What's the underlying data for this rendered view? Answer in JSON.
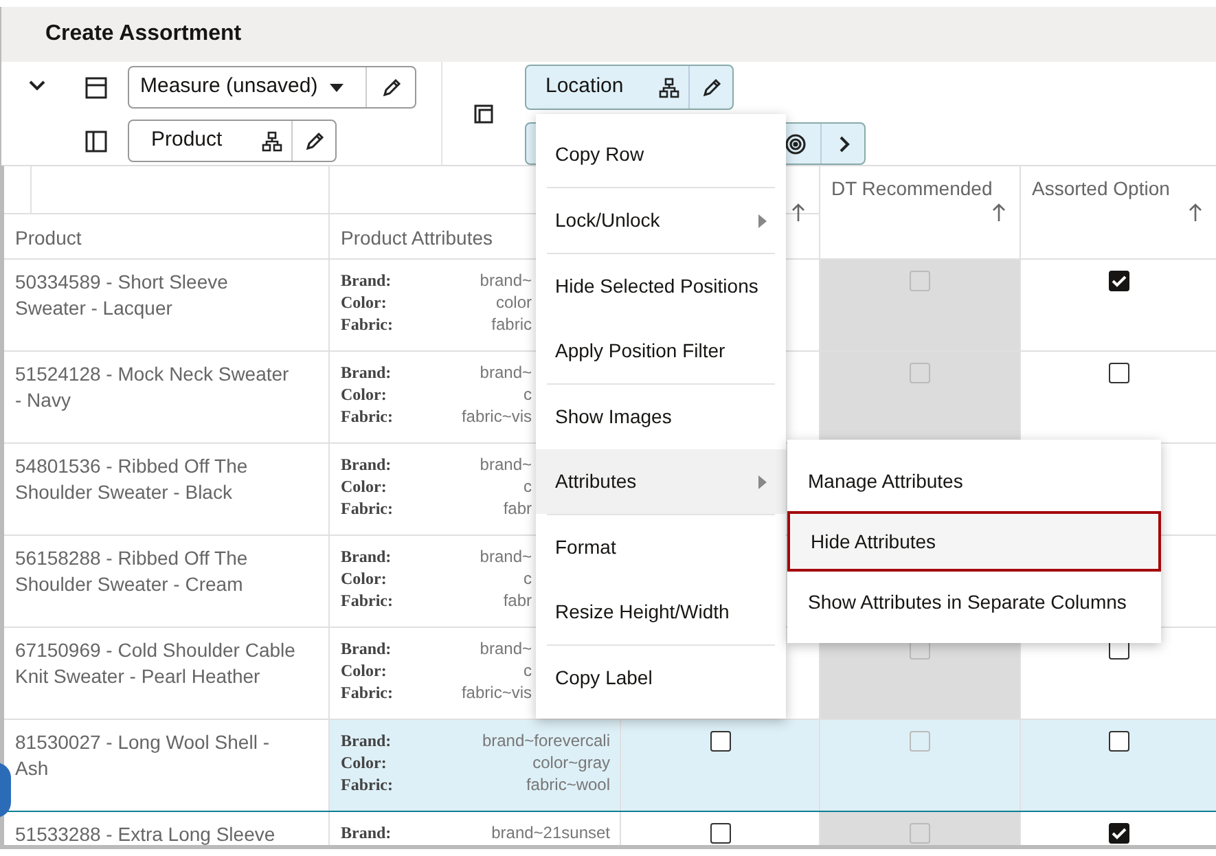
{
  "title": "Create Assortment",
  "toolbar": {
    "expanded": true,
    "measure": {
      "label": "Measure (unsaved)"
    },
    "product": {
      "label": "Product"
    },
    "location": {
      "label": "Location"
    }
  },
  "table": {
    "columns": [
      {
        "label": "Product",
        "sortable": false
      },
      {
        "label": "Product Attributes",
        "sortable": false
      },
      {
        "sortable": true
      },
      {
        "label": "DT Recommended",
        "sortable": true
      },
      {
        "label": "Assorted Option",
        "sortable": true
      }
    ],
    "rows": [
      {
        "product": "50334589 - Short Sleeve Sweater - Lacquer",
        "selected": false,
        "attributes": [
          {
            "name": "Brand:",
            "value": "brand~"
          },
          {
            "name": "Color:",
            "value": "color"
          },
          {
            "name": "Fabric:",
            "value": "fabric"
          }
        ],
        "dt_recommended": {
          "checked": false,
          "disabled": true
        },
        "assorted_option": {
          "checked": true,
          "disabled": false
        }
      },
      {
        "product": "51524128 - Mock Neck Sweater - Navy",
        "selected": false,
        "attributes": [
          {
            "name": "Brand:",
            "value": "brand~"
          },
          {
            "name": "Color:",
            "value": "c"
          },
          {
            "name": "Fabric:",
            "value": "fabric~vis"
          }
        ],
        "dt_recommended": {
          "checked": false,
          "disabled": true
        },
        "assorted_option": {
          "checked": false,
          "disabled": false
        }
      },
      {
        "product": "54801536 - Ribbed Off The Shoulder Sweater - Black",
        "selected": false,
        "attributes": [
          {
            "name": "Brand:",
            "value": "brand~"
          },
          {
            "name": "Color:",
            "value": "c"
          },
          {
            "name": "Fabric:",
            "value": "fabr"
          }
        ]
      },
      {
        "product": "56158288 - Ribbed Off The Shoulder Sweater - Cream",
        "selected": false,
        "attributes": [
          {
            "name": "Brand:",
            "value": "brand~"
          },
          {
            "name": "Color:",
            "value": "c"
          },
          {
            "name": "Fabric:",
            "value": "fabr"
          }
        ]
      },
      {
        "product": "67150969 - Cold Shoulder Cable Knit Sweater - Pearl Heather",
        "selected": false,
        "attributes": [
          {
            "name": "Brand:",
            "value": "brand~"
          },
          {
            "name": "Color:",
            "value": "c"
          },
          {
            "name": "Fabric:",
            "value": "fabric~vis"
          }
        ],
        "dt_recommended": {
          "checked": false,
          "disabled": true
        },
        "assorted_option": {
          "checked": false,
          "disabled": false
        }
      },
      {
        "product": "81530027 - Long Wool Shell - Ash",
        "selected": true,
        "attributes": [
          {
            "name": "Brand:",
            "value": "brand~forevercali"
          },
          {
            "name": "Color:",
            "value": "color~gray"
          },
          {
            "name": "Fabric:",
            "value": "fabric~wool"
          }
        ],
        "column_3": {
          "checked": false,
          "disabled": false
        },
        "dt_recommended": {
          "checked": false,
          "disabled": true
        },
        "assorted_option": {
          "checked": false,
          "disabled": false
        }
      },
      {
        "product": "51533288 - Extra Long Sleeve",
        "selected": false,
        "attributes": [
          {
            "name": "Brand:",
            "value": "brand~21sunset"
          }
        ],
        "column_3": {
          "checked": false,
          "disabled": false
        },
        "dt_recommended": {
          "checked": false,
          "disabled": true
        },
        "assorted_option": {
          "checked": true,
          "disabled": false
        }
      }
    ]
  },
  "context_menu": {
    "groups": [
      [
        {
          "label": "Copy Row",
          "has_submenu": false,
          "expanded": false
        }
      ],
      [
        {
          "label": "Lock/Unlock",
          "has_submenu": true,
          "expanded": false
        }
      ],
      [
        {
          "label": "Hide Selected Positions",
          "has_submenu": false,
          "expanded": false
        },
        {
          "label": "Apply Position Filter",
          "has_submenu": false,
          "expanded": false
        }
      ],
      [
        {
          "label": "Show Images",
          "has_submenu": false,
          "expanded": false
        },
        {
          "label": "Attributes",
          "has_submenu": true,
          "expanded": true
        }
      ],
      [
        {
          "label": "Format",
          "has_submenu": false,
          "expanded": false
        },
        {
          "label": "Resize Height/Width",
          "has_submenu": false,
          "expanded": false
        }
      ],
      [
        {
          "label": "Copy Label",
          "has_submenu": false,
          "expanded": false
        }
      ]
    ]
  },
  "submenu": {
    "items": [
      {
        "label": "Manage Attributes",
        "selected": false
      },
      {
        "label": "Hide Attributes",
        "selected": true
      },
      {
        "label": "Show Attributes in Separate Columns",
        "selected": false
      }
    ]
  }
}
